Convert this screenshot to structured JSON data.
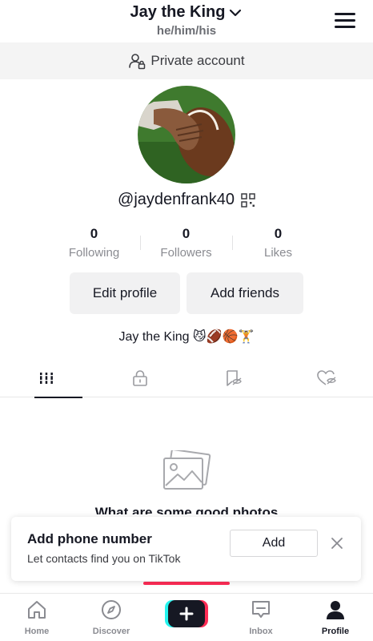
{
  "header": {
    "display_name": "Jay the King",
    "pronouns": "he/him/his"
  },
  "private_bar": {
    "label": "Private account"
  },
  "profile": {
    "username": "@jaydenfrank40",
    "bio": "Jay the King 😼🏈🏀🏋️"
  },
  "stats": [
    {
      "value": "0",
      "label": "Following"
    },
    {
      "value": "0",
      "label": "Followers"
    },
    {
      "value": "0",
      "label": "Likes"
    }
  ],
  "buttons": {
    "edit_profile": "Edit profile",
    "add_friends": "Add friends"
  },
  "tabs": [
    {
      "icon": "grid-icon",
      "active": true
    },
    {
      "icon": "lock-icon",
      "active": false
    },
    {
      "icon": "bookmark-hidden-icon",
      "active": false
    },
    {
      "icon": "heart-hidden-icon",
      "active": false
    }
  ],
  "empty_state": {
    "text": "What are some good photos"
  },
  "phone_card": {
    "title": "Add phone number",
    "subtitle": "Let contacts find you on TikTok",
    "add_label": "Add"
  },
  "bottom_nav": {
    "items": [
      {
        "label": "Home",
        "icon": "home-icon"
      },
      {
        "label": "Discover",
        "icon": "compass-icon"
      },
      {
        "label": "",
        "icon": "plus-icon"
      },
      {
        "label": "Inbox",
        "icon": "inbox-icon"
      },
      {
        "label": "Profile",
        "icon": "person-icon"
      }
    ]
  },
  "colors": {
    "accent_red": "#fe2c55",
    "accent_cyan": "#25f4ee",
    "text_primary": "#161823",
    "text_secondary": "#8a8b91"
  }
}
